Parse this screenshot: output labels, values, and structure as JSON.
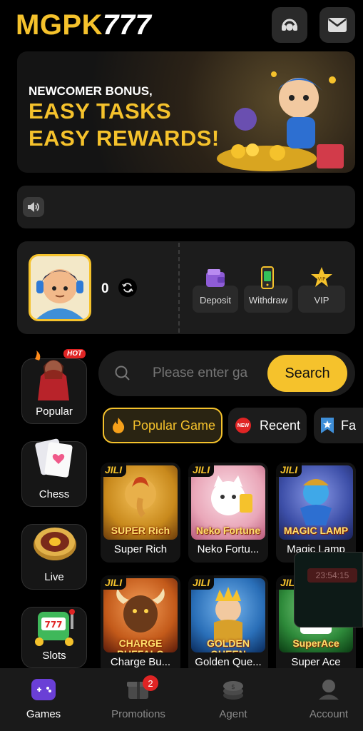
{
  "header": {
    "logo_part1": "MGPK",
    "logo_part2": "777"
  },
  "banner": {
    "line1": "NEWCOMER BONUS,",
    "line2": "EASY TASKS",
    "line3": "EASY REWARDS!"
  },
  "profile": {
    "balance": "0"
  },
  "actions": [
    {
      "label": "Deposit",
      "icon": "wallet-icon"
    },
    {
      "label": "Withdraw",
      "icon": "phone-cash-icon"
    },
    {
      "label": "VIP",
      "icon": "star-icon"
    }
  ],
  "categories": [
    {
      "label": "Popular",
      "badge": "HOT"
    },
    {
      "label": "Chess"
    },
    {
      "label": "Live"
    },
    {
      "label": "Slots"
    }
  ],
  "search": {
    "placeholder": "Please enter ga",
    "button": "Search"
  },
  "tabs": [
    {
      "label": "Popular Game"
    },
    {
      "label": "Recent",
      "icon_text": "NEW"
    },
    {
      "label": "Fa"
    }
  ],
  "games": [
    {
      "provider": "JILI",
      "title": "SUPER Rich",
      "name": "Super Rich",
      "color": "#c8891c"
    },
    {
      "provider": "JILI",
      "title": "Neko Fortune",
      "name": "Neko Fortu...",
      "color": "#e9a6b8"
    },
    {
      "provider": "JILI",
      "title": "MAGIC LAMP",
      "name": "Magic Lamp",
      "color": "#3d4fa8"
    },
    {
      "provider": "JILI",
      "title": "CHARGE BUFFALO",
      "name": "Charge Bu...",
      "color": "#c35a1a"
    },
    {
      "provider": "JILI",
      "title": "GOLDEN QUEEN",
      "name": "Golden Que...",
      "color": "#2a6fb8"
    },
    {
      "provider": "JILI",
      "title": "SuperAce",
      "name": "Super Ace",
      "color": "#2e8a3a"
    }
  ],
  "timer": {
    "text": "23:54:15"
  },
  "nav": [
    {
      "label": "Games",
      "active": true
    },
    {
      "label": "Promotions",
      "badge": "2"
    },
    {
      "label": "Agent"
    },
    {
      "label": "Account"
    }
  ],
  "colors": {
    "accent": "#f5c22c",
    "background": "#000000",
    "card": "#1c1c1c"
  }
}
